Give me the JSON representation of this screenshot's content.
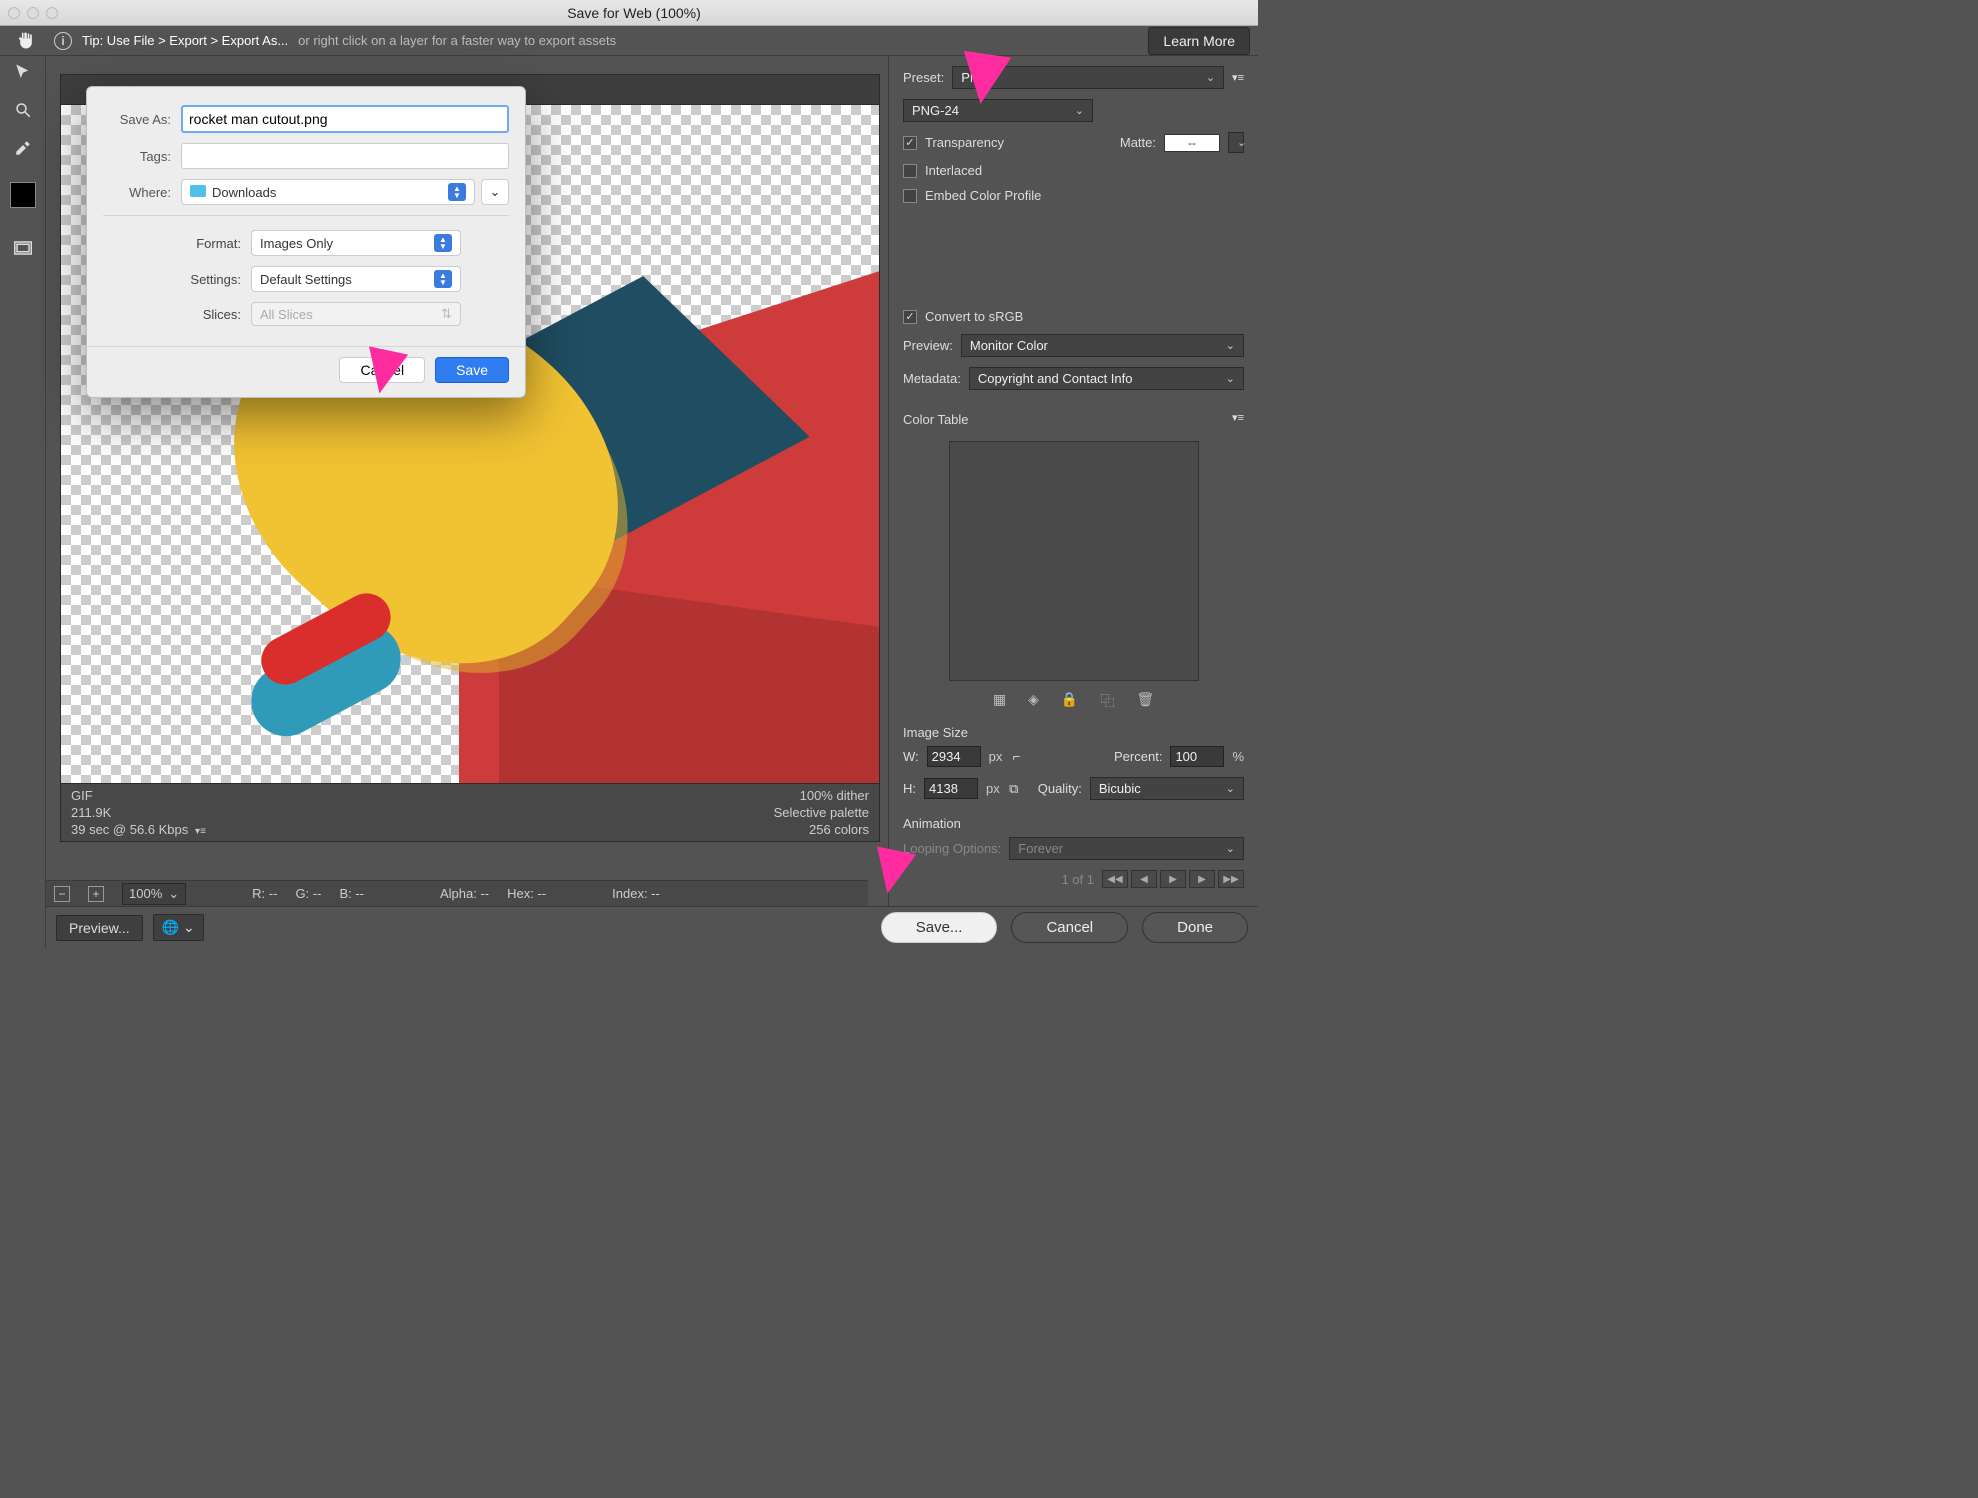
{
  "window": {
    "title": "Save for Web (100%)"
  },
  "tipbar": {
    "strong": "Tip: Use File > Export > Export As...",
    "weak": "or right click on a layer for a faster way to export assets",
    "learn_more": "Learn More"
  },
  "canvas_footer": {
    "format": "GIF",
    "size": "211.9K",
    "time": "39 sec @ 56.6 Kbps",
    "dither": "100% dither",
    "palette": "Selective palette",
    "colors": "256 colors"
  },
  "statusbar": {
    "zoom": "100%",
    "r": "R: --",
    "g": "G: --",
    "b": "B: --",
    "alpha": "Alpha: --",
    "hex": "Hex: --",
    "index": "Index: --"
  },
  "bottom": {
    "preview": "Preview...",
    "save": "Save...",
    "cancel": "Cancel",
    "done": "Done"
  },
  "right": {
    "preset_label": "Preset:",
    "preset_value": "PNG",
    "format_value": "PNG-24",
    "transparency": "Transparency",
    "matte_label": "Matte:",
    "matte_value": "--",
    "interlaced": "Interlaced",
    "embed": "Embed Color Profile",
    "convert": "Convert to sRGB",
    "preview_label": "Preview:",
    "preview_value": "Monitor Color",
    "metadata_label": "Metadata:",
    "metadata_value": "Copyright and Contact Info",
    "colortable_label": "Color Table",
    "imagesize_label": "Image Size",
    "w_label": "W:",
    "w_value": "2934",
    "h_label": "H:",
    "h_value": "4138",
    "px": "px",
    "percent_label": "Percent:",
    "percent_value": "100",
    "percent_unit": "%",
    "quality_label": "Quality:",
    "quality_value": "Bicubic",
    "animation_label": "Animation",
    "looping_label": "Looping Options:",
    "looping_value": "Forever",
    "frame": "1 of 1"
  },
  "save_dialog": {
    "saveas_label": "Save As:",
    "filename": "rocket man cutout.png",
    "tags_label": "Tags:",
    "where_label": "Where:",
    "where_value": "Downloads",
    "format_label": "Format:",
    "format_value": "Images Only",
    "settings_label": "Settings:",
    "settings_value": "Default Settings",
    "slices_label": "Slices:",
    "slices_value": "All Slices",
    "cancel": "Cancel",
    "save": "Save"
  }
}
